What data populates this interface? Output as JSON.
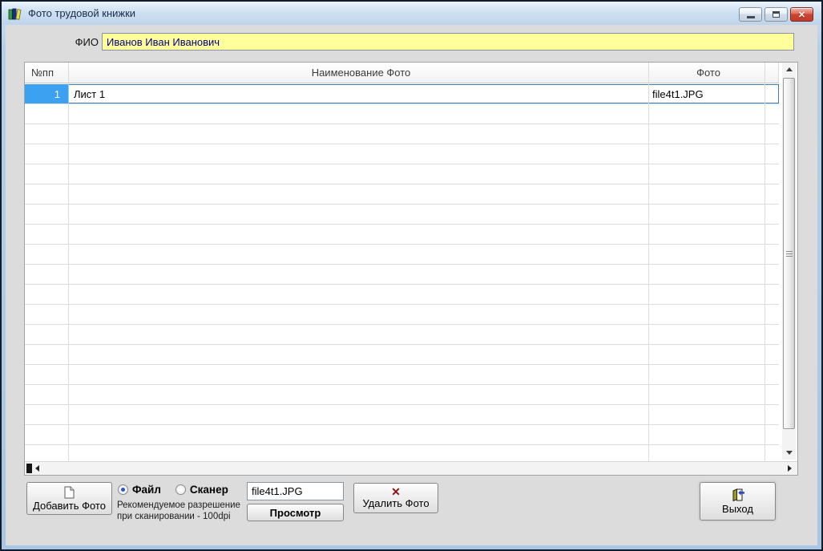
{
  "titlebar": {
    "title": "Фото трудовой книжки",
    "close_glyph": "✕"
  },
  "fio": {
    "label": "ФИО",
    "value": "Иванов Иван Иванович"
  },
  "grid": {
    "columns": [
      "№пп",
      "Наименование Фото",
      "Фото"
    ],
    "rows": [
      {
        "num": "1",
        "name": "Лист 1",
        "photo": "file4t1.JPG"
      }
    ],
    "selected_row": 0,
    "empty_rows": 18
  },
  "controls": {
    "add_label": "Добавить Фото",
    "source_options": [
      "Файл",
      "Сканер"
    ],
    "source_selected": "Файл",
    "hint_line1": "Рекомендуемое разрешение",
    "hint_line2": "при сканировании - 100dpi",
    "filename": "file4t1.JPG",
    "preview_label": "Просмотр",
    "delete_label": "Удалить Фото",
    "delete_icon_glyph": "✕",
    "exit_label": "Выход"
  },
  "colors": {
    "selection_blue": "#3ba1f0",
    "selection_border": "#3c7fb5",
    "fio_background": "#ffff9c",
    "fio_text": "#000080",
    "titlebar_blue": "#cfe1f2",
    "close_red": "#cc4632",
    "delete_x_red": "#8e1212"
  }
}
